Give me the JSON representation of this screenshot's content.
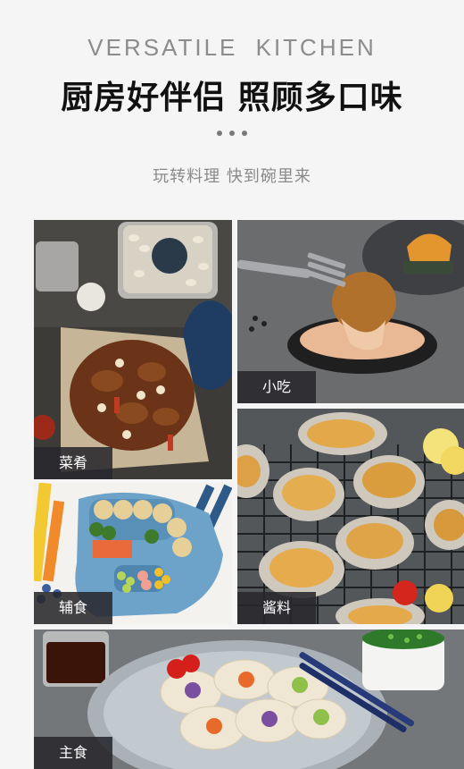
{
  "header": {
    "eyebrow": "VERSATILE  KITCHEN",
    "title": "厨房好伴侣 照顾多口味",
    "subtitle": "玩转料理 快到碗里来"
  },
  "tiles": {
    "dishes": {
      "label": "菜肴"
    },
    "snacks": {
      "label": "小吃"
    },
    "baby": {
      "label": "辅食"
    },
    "sauce": {
      "label": "酱料"
    },
    "staple": {
      "label": "主食"
    }
  },
  "colors": {
    "background": "#f5f5f5",
    "title": "#111111",
    "label_bg": "#28282c"
  }
}
